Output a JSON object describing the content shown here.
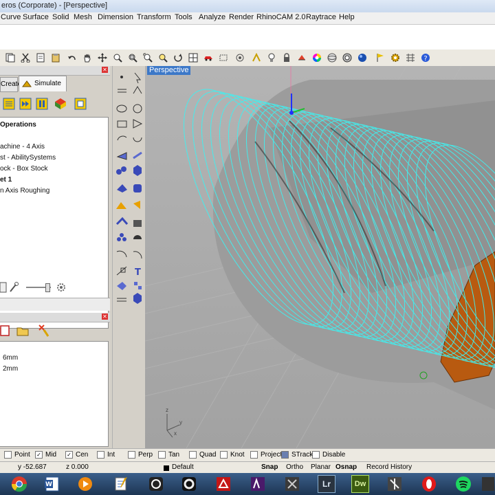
{
  "window": {
    "title": "eros (Corporate) - [Perspective]"
  },
  "menu": [
    "Curve",
    "Surface",
    "Solid",
    "Mesh",
    "Dimension",
    "Transform",
    "Tools",
    "Analyze",
    "Render",
    "RhinoCAM 2.0",
    "Raytrace",
    "Help"
  ],
  "toolbar_icons": [
    "copy-icon",
    "cut-icon",
    "duplicate-icon",
    "paste-icon",
    "pan-hand-icon",
    "move-view-icon",
    "zoom-icon",
    "zoom-window-icon",
    "zoom-extents-icon",
    "zoom-selected-icon",
    "rotate-view-icon",
    "four-viewports-icon",
    "car-icon",
    "bbox-icon",
    "camera-icon",
    "object-snap-icon",
    "layer-icon",
    "light-bulb-icon",
    "lock-icon",
    "material-icon",
    "color-wheel-icon",
    "sphere-render-icon",
    "render-icon",
    "display-icon",
    "flag-icon",
    "settings-gear-icon",
    "grid-tools-icon",
    "help-icon"
  ],
  "machining_panel": {
    "tabs": {
      "create": "Create",
      "simulate": "Simulate"
    },
    "tree": {
      "title": "Operations",
      "items": [
        "achine - 4 Axis",
        "st - AbilitySystems",
        "ock - Box Stock",
        "et 1",
        "n Axis Roughing"
      ]
    }
  },
  "second_panel": {
    "values": [
      "6mm",
      "2mm"
    ]
  },
  "viewport": {
    "label": "Perspective",
    "axis_labels": {
      "z": "z",
      "y": "y",
      "x": "x"
    }
  },
  "osnap": {
    "items": [
      {
        "label": "Point",
        "checked": false
      },
      {
        "label": "Mid",
        "checked": true
      },
      {
        "label": "Cen",
        "checked": true
      },
      {
        "label": "Int",
        "checked": false
      },
      {
        "label": "Perp",
        "checked": false
      },
      {
        "label": "Tan",
        "checked": false
      },
      {
        "label": "Quad",
        "checked": false
      },
      {
        "label": "Knot",
        "checked": false
      },
      {
        "label": "Project",
        "checked": false
      },
      {
        "label": "STrack",
        "checked": true
      },
      {
        "label": "Disable",
        "checked": false
      }
    ]
  },
  "status": {
    "y": "y -52.687",
    "z": "z 0.000",
    "layer": "Default",
    "snap": "Snap",
    "ortho": "Ortho",
    "planar": "Planar",
    "osnap": "Osnap",
    "record_history": "Record History"
  },
  "taskbar": {
    "apps": [
      "chrome",
      "word",
      "media-player",
      "notepad",
      "app-5",
      "app-6",
      "acrobat",
      "illustrator",
      "app-9",
      "lightroom",
      "dreamweaver",
      "photoshop",
      "app-13",
      "opera",
      "spotify",
      "app-16"
    ],
    "lr_label": "Lr",
    "dw_label": "Dw"
  },
  "colors": {
    "toolpath": "#40f0f0",
    "stock": "#b85a10",
    "viewport_bg": "#a9a9a9",
    "title_tag": "#3c78c8"
  }
}
